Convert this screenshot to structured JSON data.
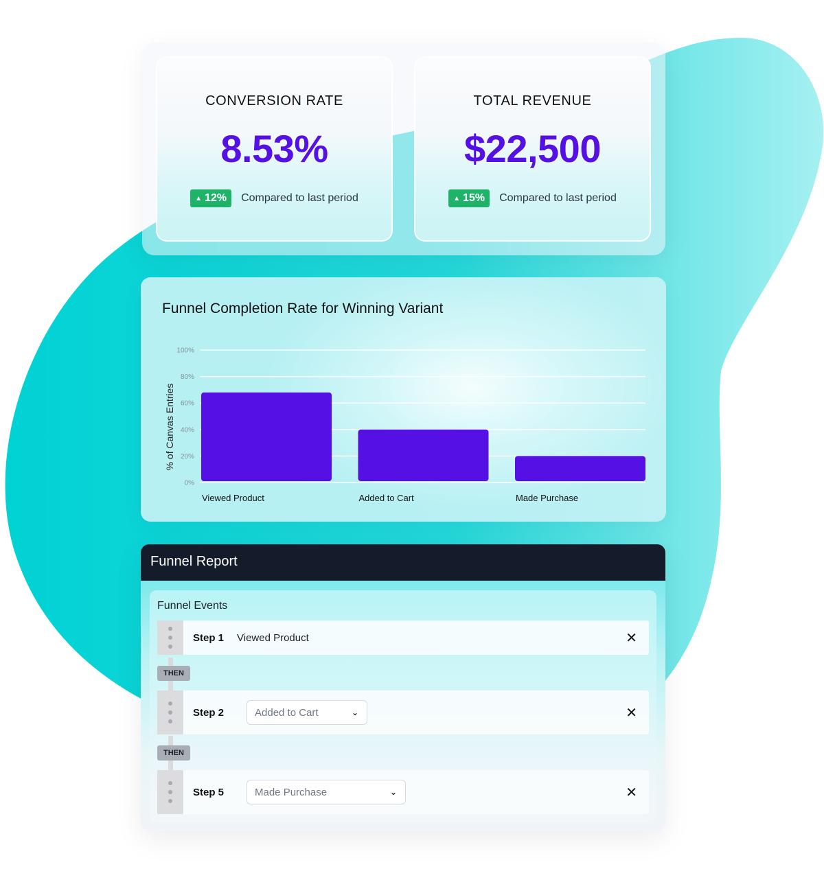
{
  "colors": {
    "accent": "#5511e3",
    "bar": "#5511e3",
    "badge_green": "#1fb36a",
    "header_dark": "#141b2a",
    "blob_teal": "#00d4d6"
  },
  "metrics": [
    {
      "title": "CONVERSION RATE",
      "value": "8.53%",
      "change": "12%",
      "change_icon": "triangle-up-icon",
      "compare_text": "Compared to last period"
    },
    {
      "title": "TOTAL REVENUE",
      "value": "$22,500",
      "change": "15%",
      "change_icon": "triangle-up-icon",
      "compare_text": "Compared to last period"
    }
  ],
  "chart_data": {
    "type": "bar",
    "title": "Funnel Completion Rate for Winning Variant",
    "xlabel": "",
    "ylabel": "% of Canvas Entries",
    "categories": [
      "Viewed Product",
      "Added to Cart",
      "Made Purchase"
    ],
    "values": [
      68,
      40,
      20
    ],
    "ylim": [
      0,
      100
    ],
    "yticks": [
      "0%",
      "20%",
      "40%",
      "60%",
      "80%",
      "100%"
    ],
    "grid": true
  },
  "report": {
    "title": "Funnel Report",
    "events_title": "Funnel Events",
    "connector_label": "THEN",
    "steps": [
      {
        "label": "Step 1",
        "value": "Viewed Product",
        "type": "text"
      },
      {
        "label": "Step 2",
        "value": "Added to Cart",
        "type": "select"
      },
      {
        "label": "Step 5",
        "value": "Made Purchase",
        "type": "select"
      }
    ],
    "close_glyph": "✕",
    "chevron_glyph": "⌄"
  }
}
